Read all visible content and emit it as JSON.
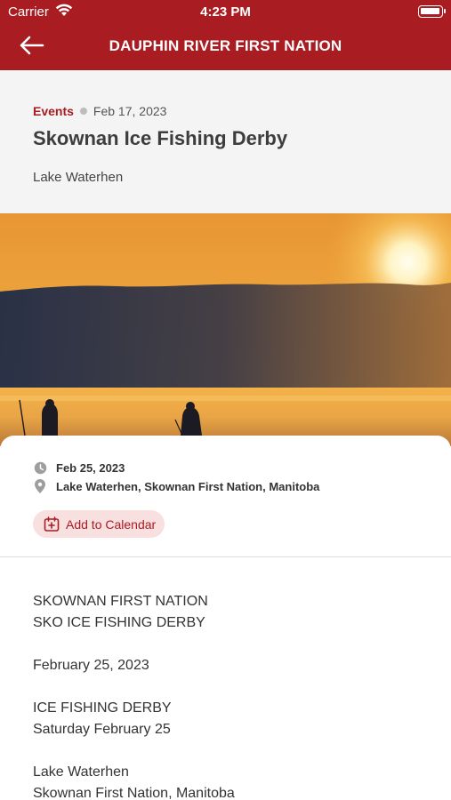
{
  "status_bar": {
    "carrier": "Carrier",
    "time": "4:23 PM"
  },
  "header": {
    "title": "DAUPHIN RIVER FIRST NATION",
    "back_icon": "arrow-left-icon"
  },
  "post": {
    "category": "Events",
    "date": "Feb 17, 2023",
    "title": "Skownan Ice Fishing Derby",
    "subtitle": "Lake Waterhen"
  },
  "hero": {
    "description_icon": "sunset-ice-fishing-photo"
  },
  "details": {
    "event_date": "Feb 25, 2023",
    "location": "Lake Waterhen, Skownan First Nation, Manitoba",
    "calendar_button": "Add to Calendar"
  },
  "body": {
    "paragraphs": [
      [
        "SKOWNAN FIRST NATION",
        "SKO ICE FISHING DERBY"
      ],
      [
        "February 25, 2023"
      ],
      [
        "ICE FISHING DERBY",
        "Saturday February 25"
      ],
      [
        "Lake Waterhen",
        "Skownan First Nation, Manitoba"
      ]
    ]
  },
  "colors": {
    "brand": "#a81c22",
    "accent_bg": "#f8e0e1",
    "header_bg": "#f4f4f4"
  }
}
